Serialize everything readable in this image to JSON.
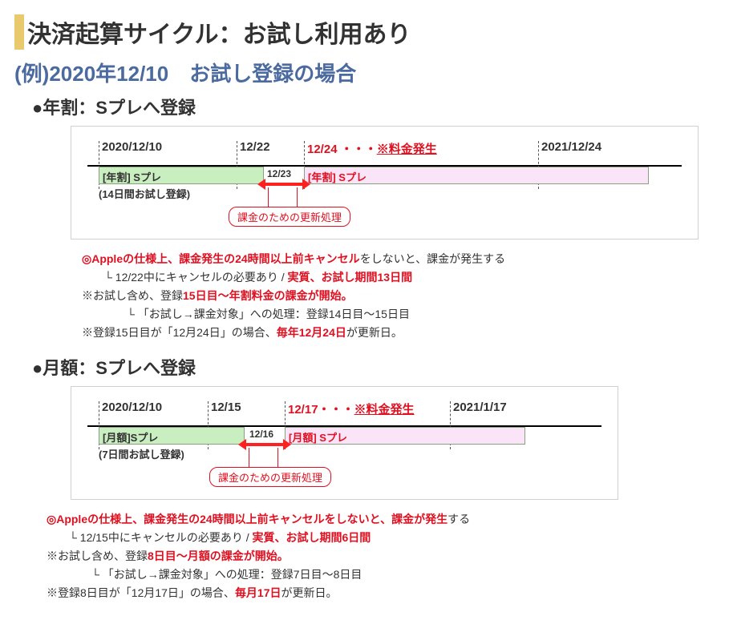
{
  "title": "決済起算サイクル：お試し利用あり",
  "subtitle": "(例)2020年12/10　お試し登録の場合",
  "sec1": {
    "head": "●年割：Sプレへ登録",
    "tick_start": "2020/12/10",
    "tick_cancel": "12/22",
    "tick_mid": "12/23",
    "tick_charge_date": "12/24 ・・・",
    "charge_notice": "※料金発生",
    "tick_end": "2021/12/24",
    "trial_label": "[年割]  Sプレ",
    "trial_note": "(14日間お試し登録)",
    "paid_label": "[年割] Sプレ",
    "callout": "課金のための更新処理"
  },
  "notes1": {
    "l1a": "◎Appleの仕様上、",
    "l1b": "課金発生の24時間以上前キャンセル",
    "l1c": "をしないと、課金が発生する",
    "l2a": "└ 12/22中にキャンセルの必要あり / ",
    "l2b": "実質、お試し期間13日間",
    "l3a": "※お試し含め、登録",
    "l3b": "15日目～年割料金の課金が開始。",
    "l4": "└ 「お試し→課金対象」への処理：登録14日目～15日目",
    "l5a": "※登録15日目が「12月24日」の場合、",
    "l5b": "毎年12月24日",
    "l5c": "が更新日。"
  },
  "sec2": {
    "head": "●月額：Sプレへ登録",
    "tick_start": "2020/12/10",
    "tick_cancel": "12/15",
    "tick_mid": "12/16",
    "tick_charge_date": "12/17・・・",
    "charge_notice": "※料金発生",
    "tick_end": "2021/1/17",
    "trial_label": "[月額]Sプレ",
    "trial_note": "(7日間お試し登録)",
    "paid_label": "[月額] Sプレ",
    "callout": "課金のための更新処理"
  },
  "notes2": {
    "l1a": "◎Appleの仕様上、",
    "l1b": "課金発生の24時間以上前キャンセルをしないと、課金が発生",
    "l1c": "する",
    "l2a": "└ 12/15中にキャンセルの必要あり / ",
    "l2b": "実質、お試し期間6日間",
    "l3a": "※お試し含め、登録",
    "l3b": "8日目～月額の課金が開始。",
    "l4": "└ 「お試し→課金対象」への処理：登録7日目～8日目",
    "l5a": "※登録8日目が「12月17日」の場合、",
    "l5b": "毎月17日",
    "l5c": "が更新日。"
  }
}
